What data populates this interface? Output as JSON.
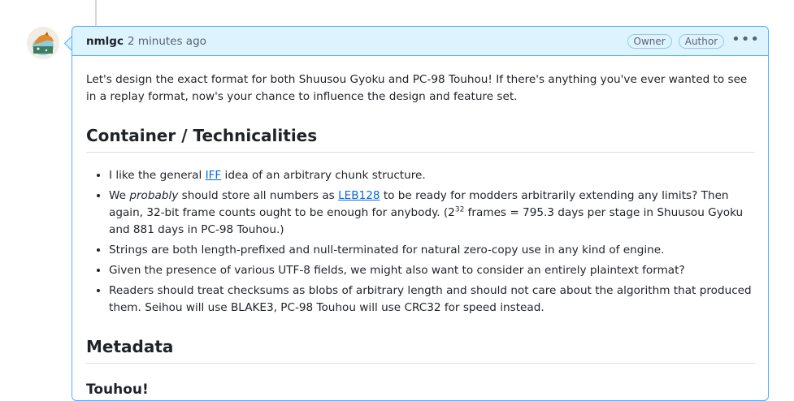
{
  "comment": {
    "author": "nmlgc",
    "timestamp": "2 minutes ago",
    "badges": [
      "Owner",
      "Author"
    ],
    "menu_icon": "kebab-horizontal-icon"
  },
  "body": {
    "intro": "Let's design the exact format for both Shuusou Gyoku and PC-98 Touhou! If there's anything you've ever wanted to see in a replay format, now's your chance to influence the design and feature set.",
    "section1_title": "Container / Technicalities",
    "bullets": {
      "b1_pre": "I like the general ",
      "b1_link": "IFF",
      "b1_post": " idea of an arbitrary chunk structure.",
      "b2_pre": "We ",
      "b2_em": "probably",
      "b2_mid": " should store all numbers as ",
      "b2_link": "LEB128",
      "b2_post": " to be ready for modders arbitrarily extending any limits? Then again, 32-bit frame counts ought to be enough for anybody. (2",
      "b2_sup": "32",
      "b2_end": " frames = 795.3 days per stage in Shuusou Gyoku and 881 days in PC-98 Touhou.)",
      "b3": "Strings are both length-prefixed and null-terminated for natural zero-copy use in any kind of engine.",
      "b4": "Given the presence of various UTF-8 fields, we might also want to consider an entirely plaintext format?",
      "b5": "Readers should treat checksums as blobs of arbitrary length and should not care about the algorithm that produced them. Seihou will use BLAKE3, PC-98 Touhou will use CRC32 for speed instead."
    },
    "section2_title": "Metadata",
    "section3_partial": "Touhou!"
  }
}
